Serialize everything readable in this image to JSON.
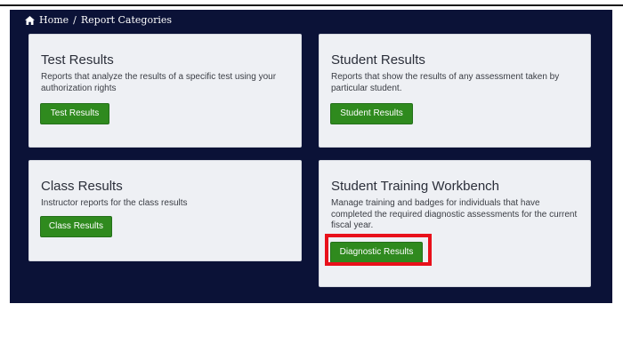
{
  "breadcrumb": {
    "home_label": "Home",
    "separator": "/",
    "current": "Report Categories"
  },
  "cards": [
    {
      "title": "Test Results",
      "description": "Reports that analyze the results of a specific test using your authorization rights",
      "button_label": "Test Results"
    },
    {
      "title": "Student Results",
      "description": "Reports that show the results of any assessment taken by particular student.",
      "button_label": "Student Results"
    },
    {
      "title": "Class Results",
      "description": "Instructor reports for the class results",
      "button_label": "Class Results"
    },
    {
      "title": "Student Training Workbench",
      "description": "Manage training and badges for individuals that have completed the required diagnostic assessments for the current fiscal year.",
      "button_label": "Diagnostic Results"
    }
  ],
  "colors": {
    "panel_bg": "#0b1237",
    "card_bg": "#eef0f4",
    "button_green": "#2f8a1e",
    "highlight_red": "#e8101a"
  },
  "icons": {
    "home": "home-icon"
  }
}
